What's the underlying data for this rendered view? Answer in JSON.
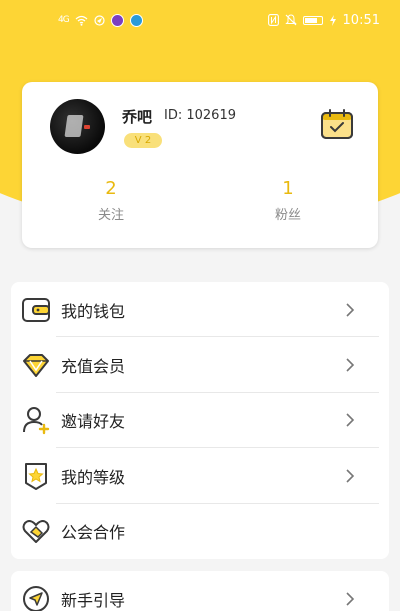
{
  "status_bar": {
    "signal_text": "4G",
    "time": "10:51"
  },
  "profile": {
    "nickname": "乔吧",
    "user_id": "ID: 102619",
    "level": "V 2",
    "follow_count": "2",
    "follow_label": "关注",
    "fans_count": "1",
    "fans_label": "粉丝"
  },
  "menu": {
    "items": [
      {
        "label": "我的钱包",
        "icon": "wallet-icon"
      },
      {
        "label": "充值会员",
        "icon": "diamond-icon"
      },
      {
        "label": "邀请好友",
        "icon": "add-friend-icon"
      },
      {
        "label": "我的等级",
        "icon": "level-star-icon"
      },
      {
        "label": "公会合作",
        "icon": "handshake-heart-icon"
      }
    ],
    "second_items": [
      {
        "label": "新手引导",
        "icon": "navigation-icon"
      }
    ]
  },
  "colors": {
    "brand_yellow": "#fdd535",
    "accent_gold": "#e9b90f",
    "icon_dark": "#3a3a3a"
  }
}
